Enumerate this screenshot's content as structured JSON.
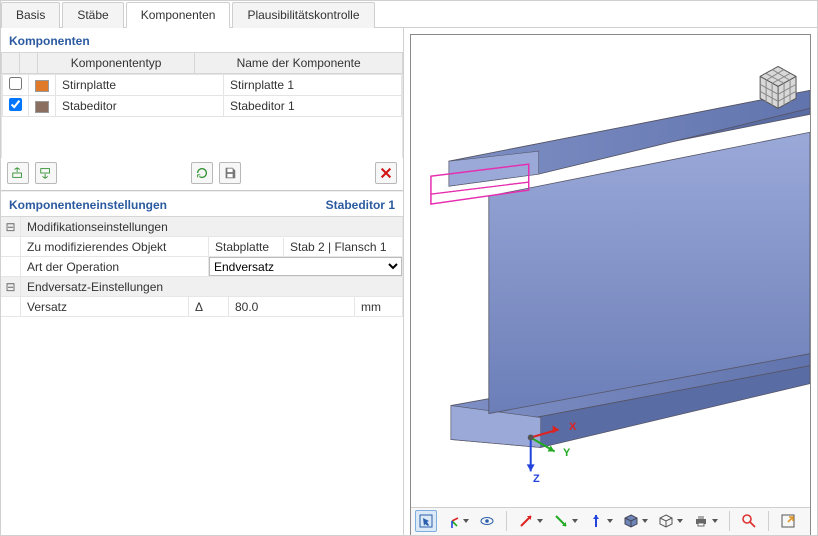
{
  "tabs": {
    "basis": "Basis",
    "staebe": "Stäbe",
    "komponenten": "Komponenten",
    "plausi": "Plausibilitätskontrolle",
    "active": "komponenten"
  },
  "komponenten": {
    "title": "Komponenten",
    "col_type": "Komponententyp",
    "col_name": "Name der Komponente",
    "rows": [
      {
        "checked": false,
        "color": "#e07a28",
        "type": "Stirnplatte",
        "name": "Stirnplatte 1"
      },
      {
        "checked": true,
        "color": "#8a6f60",
        "type": "Stabeditor",
        "name": "Stabeditor 1"
      }
    ]
  },
  "settings": {
    "title": "Komponenteneinstellungen",
    "current": "Stabeditor 1",
    "mod_section": "Modifikationseinstellungen",
    "obj_label": "Zu modifizierendes Objekt",
    "obj_v1": "Stabplatte",
    "obj_v2": "Stab 2 | Flansch 1",
    "op_label": "Art der Operation",
    "op_value": "Endversatz",
    "end_section": "Endversatz-Einstellungen",
    "offset_label": "Versatz",
    "offset_delta": "Δ",
    "offset_value": "80.0",
    "offset_unit": "mm"
  },
  "viewer": {
    "axes": {
      "x": "X",
      "y": "Y",
      "z": "Z"
    }
  }
}
